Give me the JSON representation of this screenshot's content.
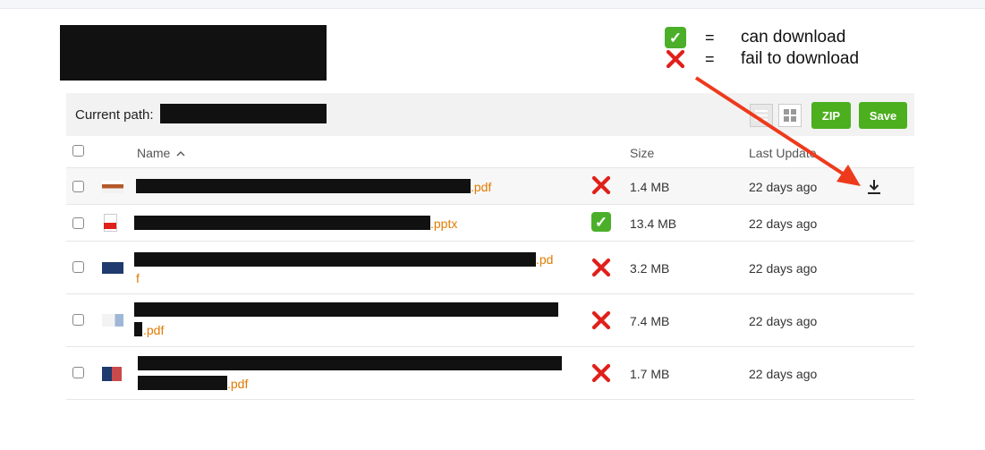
{
  "legend": {
    "can_download": "can download",
    "fail_to_download": "fail to download",
    "equals": "="
  },
  "toolbar": {
    "current_path_label": "Current path:",
    "zip_label": "ZIP",
    "save_label": "Save",
    "list_view_icon": "list-view-icon",
    "grid_view_icon": "grid-view-icon"
  },
  "table": {
    "headers": {
      "name": "Name",
      "size": "Size",
      "last_update": "Last Update"
    },
    "sort_indicator": "chevron-up-icon",
    "rows": [
      {
        "ext": ".pdf",
        "status": "fail",
        "size": "1.4 MB",
        "date": "22 days ago",
        "download_icon": "download-icon"
      },
      {
        "ext": ".pptx",
        "status": "ok",
        "size": "13.4 MB",
        "date": "22 days ago"
      },
      {
        "ext_line1": ".pd",
        "ext_line2": "f",
        "status": "fail",
        "size": "3.2 MB",
        "date": "22 days ago"
      },
      {
        "ext": ".pdf",
        "status": "fail",
        "size": "7.4 MB",
        "date": "22 days ago"
      },
      {
        "ext": ".pdf",
        "status": "fail",
        "size": "1.7 MB",
        "date": "22 days ago"
      }
    ]
  },
  "colors": {
    "accent_green": "#4caf1e",
    "filename_orange": "#e07b00",
    "fail_red": "#e0201a",
    "arrow_red": "#ee3a1c"
  }
}
